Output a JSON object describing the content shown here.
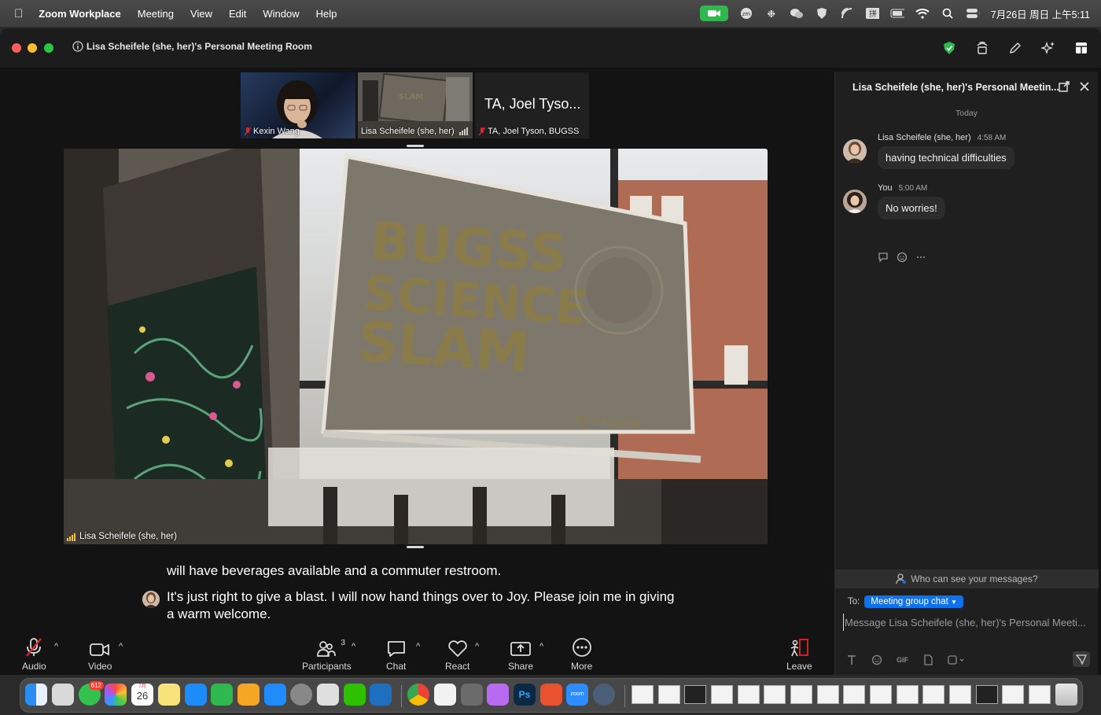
{
  "menubar": {
    "app": "Zoom Workplace",
    "menus": [
      "Meeting",
      "View",
      "Edit",
      "Window",
      "Help"
    ],
    "clock": "7月26日 周日 上午5:11"
  },
  "window": {
    "title": "Lisa Scheifele (she, her)'s Personal Meeting Room"
  },
  "thumbnails": [
    {
      "name": "Kexin Wang",
      "muted": true
    },
    {
      "name": "Lisa Scheifele (she, her)",
      "active": true
    },
    {
      "big": "TA, Joel Tyso...",
      "name": "TA, Joel Tyson, BUGSS",
      "muted": true
    }
  ],
  "stage": {
    "speaker": "Lisa Scheifele (she, her)",
    "sign_line1": "BUGSS",
    "sign_line2": "SCIENCE",
    "sign_line3": "SLAM",
    "sign_small": "All welcome"
  },
  "captions": {
    "line_prev": "will have beverages available and a commuter restroom.",
    "line1": "It's just right to give a blast. I will now hand things over to Joy. Please join me in giving",
    "line2": "a warm welcome."
  },
  "toolbar": {
    "audio": "Audio",
    "video": "Video",
    "participants": "Participants",
    "participants_count": "3",
    "chat": "Chat",
    "react": "React",
    "share": "Share",
    "more": "More",
    "leave": "Leave"
  },
  "chat": {
    "title": "Lisa Scheifele (she, her)'s Personal Meetin...",
    "today": "Today",
    "messages": [
      {
        "sender": "Lisa Scheifele (she, her)",
        "time": "4:58 AM",
        "text": "having technical difficulties"
      },
      {
        "sender": "You",
        "time": "5:00 AM",
        "text": "No worries!"
      }
    ],
    "who_can_see": "Who can see your messages?",
    "to_label": "To:",
    "to_target": "Meeting group chat",
    "input_placeholder": "Message Lisa Scheifele (she, her)'s Personal Meeti...",
    "gif_label": "GIF"
  },
  "dock": {
    "messages_badge": "612",
    "calendar_month": "7月",
    "calendar_day": "26",
    "zoom_label": "zoom",
    "ps_label": "Ps"
  },
  "colors": {
    "accent": "#0e72ed",
    "active_speaker": "#2fd05a",
    "mute_red": "#e0252b",
    "window_bg": "#131313"
  }
}
